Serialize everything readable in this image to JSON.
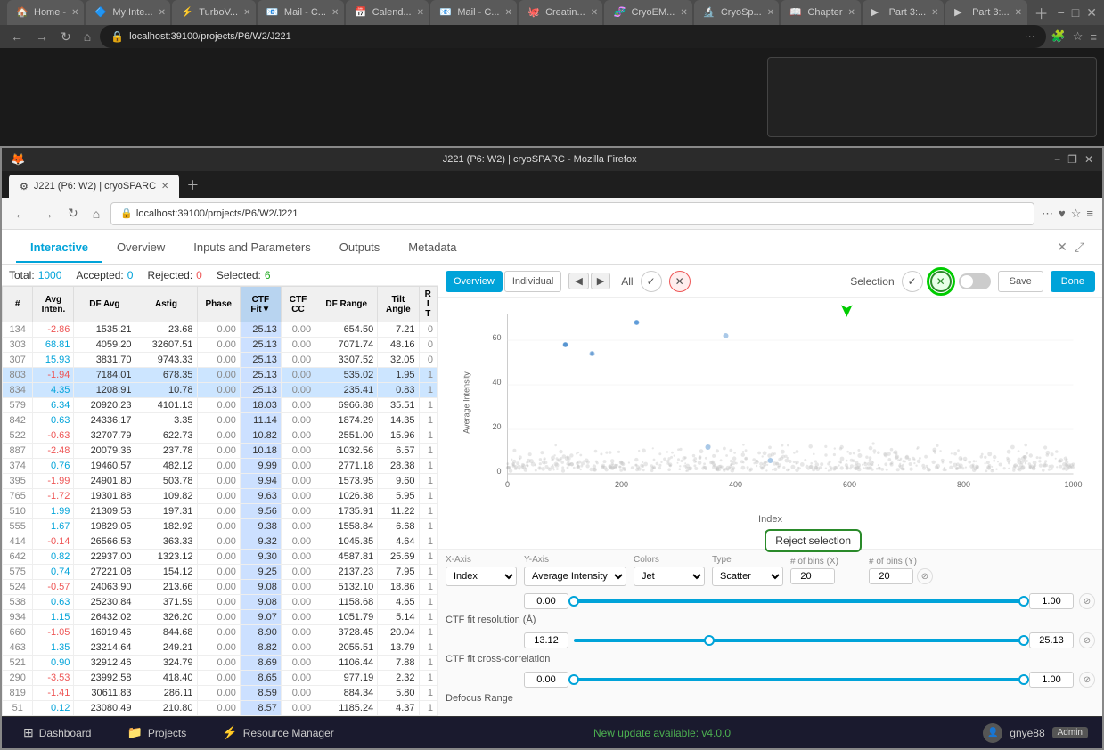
{
  "browser": {
    "tabs": [
      {
        "label": "Home -",
        "favicon": "🏠",
        "active": false
      },
      {
        "label": "My Inte...",
        "favicon": "🔷",
        "active": false
      },
      {
        "label": "TurboV...",
        "favicon": "⚡",
        "active": false
      },
      {
        "label": "Mail - C...",
        "favicon": "📧",
        "active": false
      },
      {
        "label": "Calend...",
        "favicon": "📅",
        "active": false
      },
      {
        "label": "Mail - C...",
        "favicon": "📧",
        "active": false
      },
      {
        "label": "Creatin...",
        "favicon": "🐙",
        "active": false
      },
      {
        "label": "CryoEM...",
        "favicon": "🧬",
        "active": false
      },
      {
        "label": "CryoSp...",
        "favicon": "🔬",
        "active": false
      },
      {
        "label": "Chapter",
        "favicon": "📖",
        "active": false
      },
      {
        "label": "Part 3:...",
        "favicon": "▶",
        "active": false
      },
      {
        "label": "Part 3:...",
        "favicon": "▶",
        "active": false
      }
    ],
    "url": "localhost:39100/projects/P6/W2/J221",
    "security_icon": "🔒"
  },
  "firefox": {
    "title": "J221 (P6: W2) | cryoSPARC - Mozilla Firefox",
    "tab_label": "J221 (P6: W2) | cryoSPARC",
    "tab_favicon": "⚙"
  },
  "app": {
    "tabs": [
      {
        "label": "Interactive",
        "active": true
      },
      {
        "label": "Overview",
        "active": false
      },
      {
        "label": "Inputs and Parameters",
        "active": false
      },
      {
        "label": "Outputs",
        "active": false
      },
      {
        "label": "Metadata",
        "active": false
      }
    ]
  },
  "stats": {
    "total_label": "Total:",
    "total_val": "1000",
    "accepted_label": "Accepted:",
    "accepted_val": "0",
    "rejected_label": "Rejected:",
    "rejected_val": "0",
    "selected_label": "Selected:",
    "selected_val": "6"
  },
  "table": {
    "headers": [
      "#",
      "Avg Inten.",
      "DF Avg",
      "Astig",
      "Phase",
      "CTF Fit▼",
      "CTF CC",
      "DF Range",
      "Tilt Angle",
      "R I T"
    ],
    "rows": [
      {
        "id": "134",
        "avg_inten": "-2.86",
        "df_avg": "1535.21",
        "astig": "23.68",
        "phase": "0.00",
        "ctf_fit": "25.13",
        "ctf_cc": "0.00",
        "df_range": "654.50",
        "tilt_angle": "7.21",
        "r": "0",
        "selected": false
      },
      {
        "id": "303",
        "avg_inten": "68.81",
        "df_avg": "4059.20",
        "astig": "32607.51",
        "phase": "0.00",
        "ctf_fit": "25.13",
        "ctf_cc": "0.00",
        "df_range": "7071.74",
        "tilt_angle": "48.16",
        "r": "0",
        "selected": false
      },
      {
        "id": "307",
        "avg_inten": "15.93",
        "df_avg": "3831.70",
        "astig": "9743.33",
        "phase": "0.00",
        "ctf_fit": "25.13",
        "ctf_cc": "0.00",
        "df_range": "3307.52",
        "tilt_angle": "32.05",
        "r": "0",
        "selected": false
      },
      {
        "id": "803",
        "avg_inten": "-1.94",
        "df_avg": "7184.01",
        "astig": "678.35",
        "phase": "0.00",
        "ctf_fit": "25.13",
        "ctf_cc": "0.00",
        "df_range": "535.02",
        "tilt_angle": "1.95",
        "r": "1",
        "selected": true
      },
      {
        "id": "834",
        "avg_inten": "4.35",
        "df_avg": "1208.91",
        "astig": "10.78",
        "phase": "0.00",
        "ctf_fit": "25.13",
        "ctf_cc": "0.00",
        "df_range": "235.41",
        "tilt_angle": "0.83",
        "r": "1",
        "selected": true
      },
      {
        "id": "579",
        "avg_inten": "6.34",
        "df_avg": "20920.23",
        "astig": "4101.13",
        "phase": "0.00",
        "ctf_fit": "18.03",
        "ctf_cc": "0.00",
        "df_range": "6966.88",
        "tilt_angle": "35.51",
        "r": "1",
        "selected": false
      },
      {
        "id": "842",
        "avg_inten": "0.63",
        "df_avg": "24336.17",
        "astig": "3.35",
        "phase": "0.00",
        "ctf_fit": "11.14",
        "ctf_cc": "0.00",
        "df_range": "1874.29",
        "tilt_angle": "14.35",
        "r": "1",
        "selected": false
      },
      {
        "id": "522",
        "avg_inten": "-0.63",
        "df_avg": "32707.79",
        "astig": "622.73",
        "phase": "0.00",
        "ctf_fit": "10.82",
        "ctf_cc": "0.00",
        "df_range": "2551.00",
        "tilt_angle": "15.96",
        "r": "1",
        "selected": false
      },
      {
        "id": "887",
        "avg_inten": "-2.48",
        "df_avg": "20079.36",
        "astig": "237.78",
        "phase": "0.00",
        "ctf_fit": "10.18",
        "ctf_cc": "0.00",
        "df_range": "1032.56",
        "tilt_angle": "6.57",
        "r": "1",
        "selected": false
      },
      {
        "id": "374",
        "avg_inten": "0.76",
        "df_avg": "19460.57",
        "astig": "482.12",
        "phase": "0.00",
        "ctf_fit": "9.99",
        "ctf_cc": "0.00",
        "df_range": "2771.18",
        "tilt_angle": "28.38",
        "r": "1",
        "selected": false
      },
      {
        "id": "395",
        "avg_inten": "-1.99",
        "df_avg": "24901.80",
        "astig": "503.78",
        "phase": "0.00",
        "ctf_fit": "9.94",
        "ctf_cc": "0.00",
        "df_range": "1573.95",
        "tilt_angle": "9.60",
        "r": "1",
        "selected": false
      },
      {
        "id": "765",
        "avg_inten": "-1.72",
        "df_avg": "19301.88",
        "astig": "109.82",
        "phase": "0.00",
        "ctf_fit": "9.63",
        "ctf_cc": "0.00",
        "df_range": "1026.38",
        "tilt_angle": "5.95",
        "r": "1",
        "selected": false
      },
      {
        "id": "510",
        "avg_inten": "1.99",
        "df_avg": "21309.53",
        "astig": "197.31",
        "phase": "0.00",
        "ctf_fit": "9.56",
        "ctf_cc": "0.00",
        "df_range": "1735.91",
        "tilt_angle": "11.22",
        "r": "1",
        "selected": false
      },
      {
        "id": "555",
        "avg_inten": "1.67",
        "df_avg": "19829.05",
        "astig": "182.92",
        "phase": "0.00",
        "ctf_fit": "9.38",
        "ctf_cc": "0.00",
        "df_range": "1558.84",
        "tilt_angle": "6.68",
        "r": "1",
        "selected": false
      },
      {
        "id": "414",
        "avg_inten": "-0.14",
        "df_avg": "26566.53",
        "astig": "363.33",
        "phase": "0.00",
        "ctf_fit": "9.32",
        "ctf_cc": "0.00",
        "df_range": "1045.35",
        "tilt_angle": "4.64",
        "r": "1",
        "selected": false
      },
      {
        "id": "642",
        "avg_inten": "0.82",
        "df_avg": "22937.00",
        "astig": "1323.12",
        "phase": "0.00",
        "ctf_fit": "9.30",
        "ctf_cc": "0.00",
        "df_range": "4587.81",
        "tilt_angle": "25.69",
        "r": "1",
        "selected": false
      },
      {
        "id": "575",
        "avg_inten": "0.74",
        "df_avg": "27221.08",
        "astig": "154.12",
        "phase": "0.00",
        "ctf_fit": "9.25",
        "ctf_cc": "0.00",
        "df_range": "2137.23",
        "tilt_angle": "7.95",
        "r": "1",
        "selected": false
      },
      {
        "id": "524",
        "avg_inten": "-0.57",
        "df_avg": "24063.90",
        "astig": "213.66",
        "phase": "0.00",
        "ctf_fit": "9.08",
        "ctf_cc": "0.00",
        "df_range": "5132.10",
        "tilt_angle": "18.86",
        "r": "1",
        "selected": false
      },
      {
        "id": "538",
        "avg_inten": "0.63",
        "df_avg": "25230.84",
        "astig": "371.59",
        "phase": "0.00",
        "ctf_fit": "9.08",
        "ctf_cc": "0.00",
        "df_range": "1158.68",
        "tilt_angle": "4.65",
        "r": "1",
        "selected": false
      },
      {
        "id": "934",
        "avg_inten": "1.15",
        "df_avg": "26432.02",
        "astig": "326.20",
        "phase": "0.00",
        "ctf_fit": "9.07",
        "ctf_cc": "0.00",
        "df_range": "1051.79",
        "tilt_angle": "5.14",
        "r": "1",
        "selected": false
      },
      {
        "id": "660",
        "avg_inten": "-1.05",
        "df_avg": "16919.46",
        "astig": "844.68",
        "phase": "0.00",
        "ctf_fit": "8.90",
        "ctf_cc": "0.00",
        "df_range": "3728.45",
        "tilt_angle": "20.04",
        "r": "1",
        "selected": false
      },
      {
        "id": "463",
        "avg_inten": "1.35",
        "df_avg": "23214.64",
        "astig": "249.21",
        "phase": "0.00",
        "ctf_fit": "8.82",
        "ctf_cc": "0.00",
        "df_range": "2055.51",
        "tilt_angle": "13.79",
        "r": "1",
        "selected": false
      },
      {
        "id": "521",
        "avg_inten": "0.90",
        "df_avg": "32912.46",
        "astig": "324.79",
        "phase": "0.00",
        "ctf_fit": "8.69",
        "ctf_cc": "0.00",
        "df_range": "1106.44",
        "tilt_angle": "7.88",
        "r": "1",
        "selected": false
      },
      {
        "id": "290",
        "avg_inten": "-3.53",
        "df_avg": "23992.58",
        "astig": "418.40",
        "phase": "0.00",
        "ctf_fit": "8.65",
        "ctf_cc": "0.00",
        "df_range": "977.19",
        "tilt_angle": "2.32",
        "r": "1",
        "selected": false
      },
      {
        "id": "819",
        "avg_inten": "-1.41",
        "df_avg": "30611.83",
        "astig": "286.11",
        "phase": "0.00",
        "ctf_fit": "8.59",
        "ctf_cc": "0.00",
        "df_range": "884.34",
        "tilt_angle": "5.80",
        "r": "1",
        "selected": false
      },
      {
        "id": "51",
        "avg_inten": "0.12",
        "df_avg": "23080.49",
        "astig": "210.80",
        "phase": "0.00",
        "ctf_fit": "8.57",
        "ctf_cc": "0.00",
        "df_range": "1185.24",
        "tilt_angle": "4.37",
        "r": "1",
        "selected": false
      }
    ]
  },
  "chart": {
    "overview_label": "Overview",
    "individual_label": "Individual",
    "x_axis_label": "Index",
    "y_axis_label": "Average Intensity",
    "x_tick_0": "0",
    "x_tick_200": "200",
    "x_tick_400": "400",
    "x_tick_600": "600",
    "x_tick_800": "800",
    "x_tick_1000": "1000",
    "y_tick_60": "60",
    "y_tick_40": "40",
    "y_tick_20": "20",
    "y_tick_0": "0",
    "all_label": "All",
    "selection_label": "Selection",
    "save_label": "Save",
    "done_label": "Done",
    "tooltip_text": "Reject selection"
  },
  "axis_controls": {
    "x_axis_label": "X-Axis",
    "x_axis_value": "Index",
    "x_axis_input": "0.00",
    "y_axis_label": "Y-Axis",
    "y_axis_value": "Average Intensity",
    "colors_label": "Colors",
    "colors_value": "Jet",
    "type_label": "Type",
    "type_value": "Scatter",
    "bins_x_label": "# of bins (X)",
    "bins_x_value": "20",
    "bins_y_label": "# of bins (Y)",
    "bins_y_value": "20"
  },
  "filters": {
    "ctf_resolution_label": "CTF fit resolution (Å)",
    "ctf_resolution_min": "13.12",
    "ctf_resolution_max": "25.13",
    "ctf_cc_label": "CTF fit cross-correlation",
    "ctf_cc_min": "0.00",
    "ctf_cc_max": "1.00",
    "defocus_label": "Defocus Range"
  },
  "bottom_bar": {
    "dashboard_label": "Dashboard",
    "projects_label": "Projects",
    "resource_manager_label": "Resource Manager",
    "update_notice": "New update available: v4.0.0",
    "username": "gnye88",
    "role": "Admin"
  }
}
